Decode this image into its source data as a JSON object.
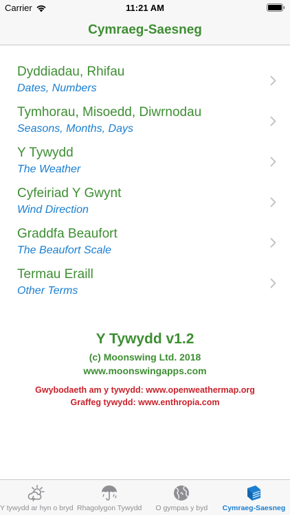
{
  "status_bar": {
    "carrier": "Carrier",
    "time": "11:21 AM",
    "icons": [
      "wifi-icon",
      "battery-icon"
    ]
  },
  "nav": {
    "title": "Cymraeg-Saesneg"
  },
  "list": [
    {
      "title": "Dyddiadau, Rhifau",
      "subtitle": "Dates, Numbers"
    },
    {
      "title": "Tymhorau, Misoedd, Diwrnodau",
      "subtitle": "Seasons, Months, Days"
    },
    {
      "title": "Y Tywydd",
      "subtitle": "The Weather"
    },
    {
      "title": "Cyfeiriad Y Gwynt",
      "subtitle": "Wind Direction"
    },
    {
      "title": "Graddfa Beaufort",
      "subtitle": "The Beaufort Scale"
    },
    {
      "title": "Termau Eraill",
      "subtitle": "Other Terms"
    }
  ],
  "about": {
    "app_title": "Y Tywydd v1.2",
    "copyright": "(c) Moonswing Ltd. 2018",
    "website": "www.moonswingapps.com",
    "credit_weather": "Gwybodaeth am y tywydd: www.openweathermap.org",
    "credit_graphics": "Graffeg tywydd: www.enthropia.com"
  },
  "tabs": [
    {
      "label": "Y tywydd ar hyn o bryd",
      "icon": "sun-cloud-icon",
      "active": false
    },
    {
      "label": "Rhagolygon Tywydd",
      "icon": "umbrella-icon",
      "active": false
    },
    {
      "label": "O gympas y byd",
      "icon": "globe-icon",
      "active": false
    },
    {
      "label": "Cymraeg-Saesneg",
      "icon": "book-icon",
      "active": true
    }
  ],
  "colors": {
    "accent_green": "#3e8e33",
    "accent_blue": "#1a7fd1",
    "credit_red": "#c8232c",
    "inactive_gray": "#8e8e93"
  }
}
